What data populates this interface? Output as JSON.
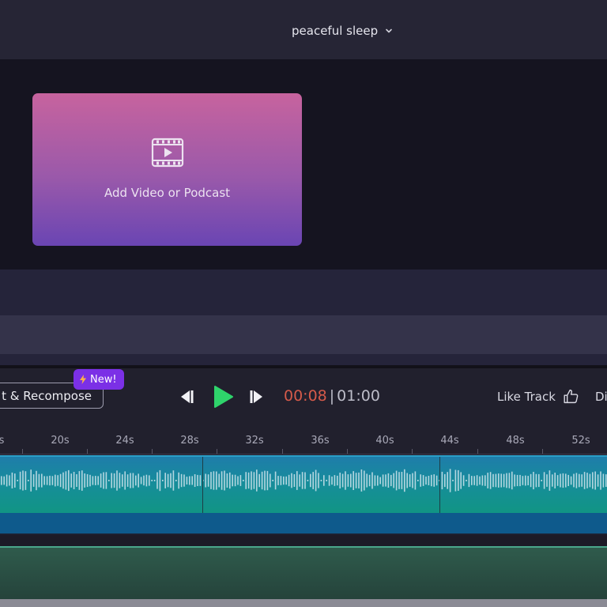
{
  "header": {
    "project_title": "peaceful sleep"
  },
  "video_card": {
    "label": "Add Video or Podcast"
  },
  "controls": {
    "recompose_label": "t & Recompose",
    "new_badge": "New!",
    "time_current": "00:08",
    "time_separator": "|",
    "time_total": "01:00",
    "like_label": "Like Track",
    "truncated_label": "Di"
  },
  "ruler": {
    "labels": [
      "s",
      "20s",
      "24s",
      "28s",
      "32s",
      "36s",
      "40s",
      "44s",
      "48s",
      "52s"
    ]
  },
  "colors": {
    "accent_play": "#2fd36b",
    "time_current": "#d55a4a",
    "badge": "#7b30e6"
  },
  "icons": {
    "title_dropdown": "chevron-down-icon",
    "video": "film-play-icon",
    "badge": "lightning-icon",
    "prev": "skip-previous-icon",
    "play": "play-icon",
    "next": "skip-next-icon",
    "like": "thumbs-up-icon"
  }
}
